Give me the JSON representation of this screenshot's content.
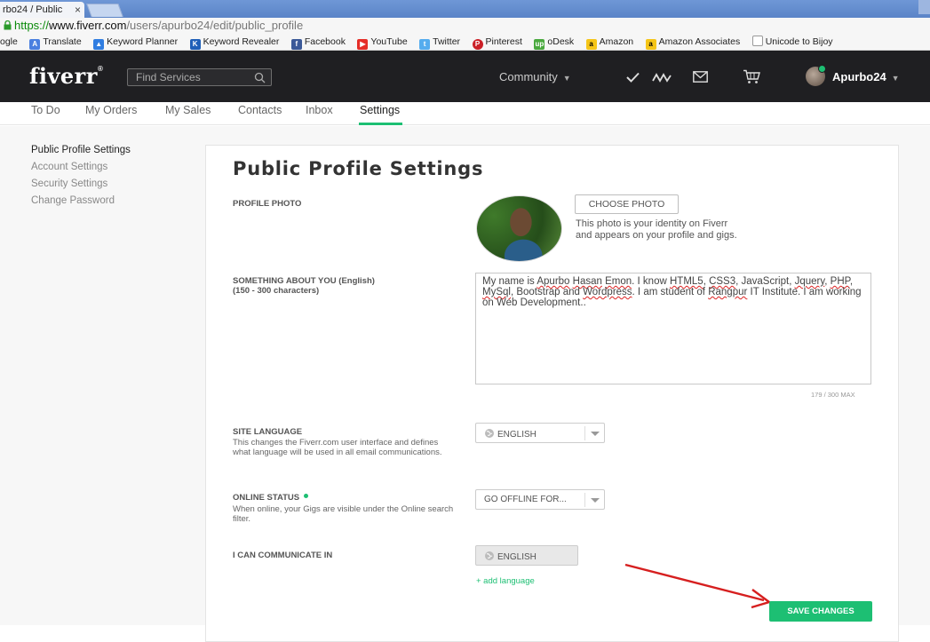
{
  "browser": {
    "tab_title": "rbo24 / Public",
    "tab_close": "×",
    "url_scheme": "https://",
    "url_host": "www.fiverr.com",
    "url_path": "/users/apurbo24/edit/public_profile",
    "bookmarks": [
      "ogle",
      "Translate",
      "Keyword Planner",
      "Keyword Revealer",
      "Facebook",
      "YouTube",
      "Twitter",
      "Pinterest",
      "oDesk",
      "Amazon",
      "Amazon Associates",
      "Unicode to Bijoy"
    ]
  },
  "header": {
    "logo": "fiverr",
    "logo_mark": "®",
    "search_placeholder": "Find Services",
    "community": "Community",
    "username": "Apurbo24"
  },
  "subnav": [
    "To Do",
    "My Orders",
    "My Sales",
    "Contacts",
    "Inbox",
    "Settings"
  ],
  "sidebar": [
    "Public Profile Settings",
    "Account Settings",
    "Security Settings",
    "Change Password"
  ],
  "main": {
    "title": "Public Profile Settings",
    "profile_photo_label": "PROFILE PHOTO",
    "choose_photo": "CHOOSE PHOTO",
    "photo_help_1": "This photo is your identity on Fiverr",
    "photo_help_2": "and appears on your profile and gigs.",
    "about_label": "SOMETHING ABOUT YOU (English)",
    "about_range": "(150 - 300 characters)",
    "about_text": {
      "p1": "My name is ",
      "w1": "Apurbo",
      "s1": " ",
      "w2": "Hasan",
      "s2": " ",
      "w3": "Emon",
      "p2": ". I know ",
      "w4": "HTML5",
      "p3": ", ",
      "w5": "CSS3",
      "p4": ", JavaScript, ",
      "w6": "Jquery",
      "p5": ", ",
      "w7": "PHP",
      "p6": ", ",
      "w8": "MySql",
      "p7": ", Bootstrap and ",
      "w9": "Wordpress",
      "p8": ". I am student of ",
      "w10": "Rangpur",
      "p9": " IT Institute. I am working on  Web Development.."
    },
    "counter": "179 / 300 MAX",
    "site_language_label": "SITE LANGUAGE",
    "site_language_help": "This changes the Fiverr.com user interface and defines what language will be used in all email communications.",
    "site_language_value": "ENGLISH",
    "online_status_label": "ONLINE STATUS",
    "online_status_help": "When online, your Gigs are visible under the Online search filter.",
    "online_status_value": "GO OFFLINE FOR...",
    "communicate_label": "I CAN COMMUNICATE IN",
    "communicate_value": "ENGLISH",
    "add_language": "+ add language",
    "save_changes": "SAVE CHANGES"
  },
  "colors": {
    "accent": "#1dbf73",
    "header_bg": "#1f1f22",
    "annotation_arrow": "#d61f1f"
  }
}
